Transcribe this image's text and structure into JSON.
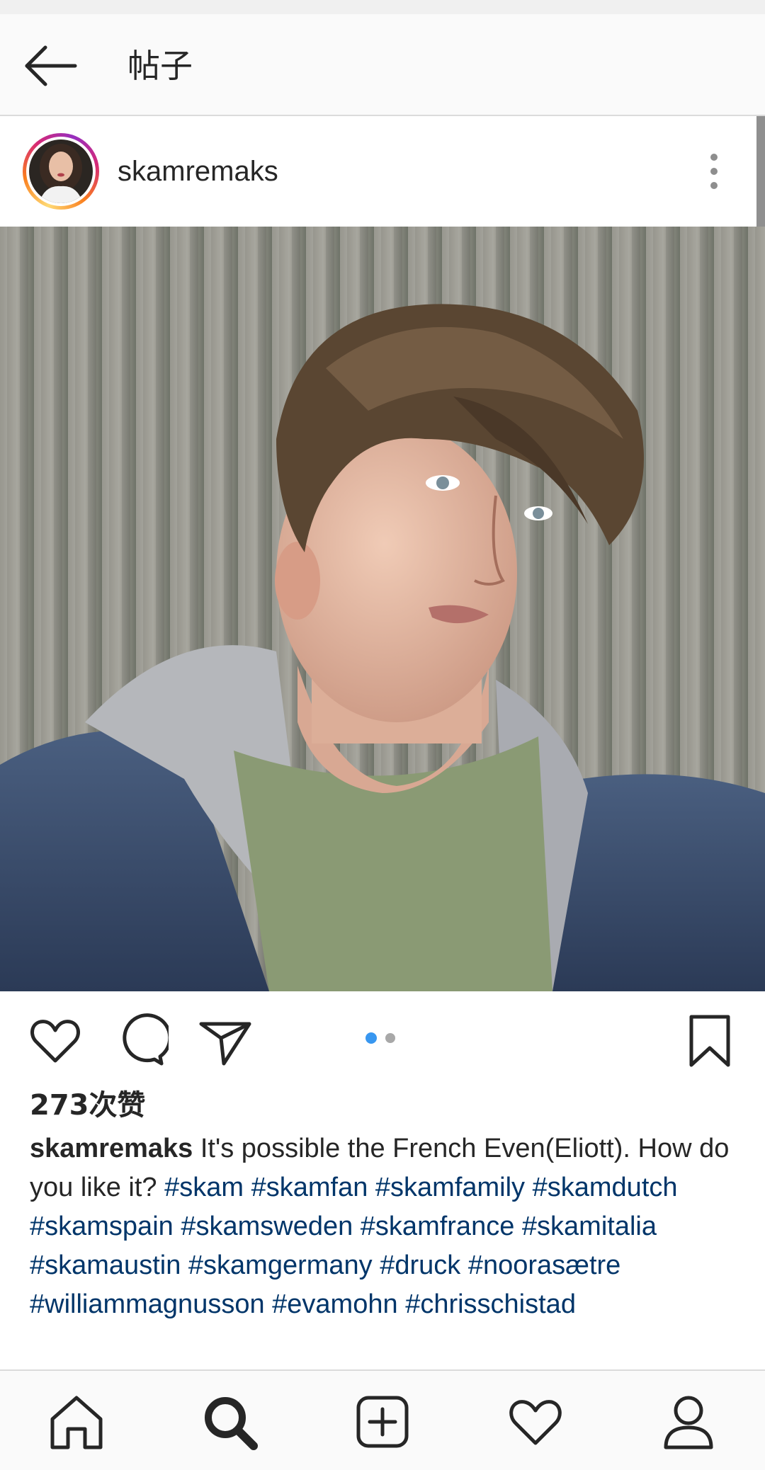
{
  "header": {
    "title": "帖子"
  },
  "post": {
    "username": "skamremaks",
    "likes": "273次赞",
    "carousel": {
      "count": 2,
      "active_index": 0
    },
    "caption": {
      "username": "skamremaks",
      "text": "It's possible the French Even(Eliott). How do you like it?",
      "hashtags": [
        "#skam",
        "#skamfan",
        "#skamfamily",
        "#skamdutch",
        "#skamspain",
        "#skamsweden",
        "#skamfrance",
        "#skamitalia",
        "#skamaustin",
        "#skamgermany",
        "#druck",
        "#noorasætre",
        "#williammagnusson",
        "#evamohn",
        "#chrisschistad"
      ]
    }
  },
  "icons": {
    "header": [
      "back-arrow-icon",
      "more-vertical-icon"
    ],
    "actions": [
      "heart-icon",
      "comment-icon",
      "share-icon",
      "bookmark-icon"
    ],
    "nav": [
      "home-icon",
      "search-icon",
      "add-post-icon",
      "activity-heart-icon",
      "profile-icon"
    ]
  },
  "colors": {
    "hashtag": "#003569",
    "dot_active": "#3897f0",
    "dot_inactive": "#a8a8a8"
  }
}
